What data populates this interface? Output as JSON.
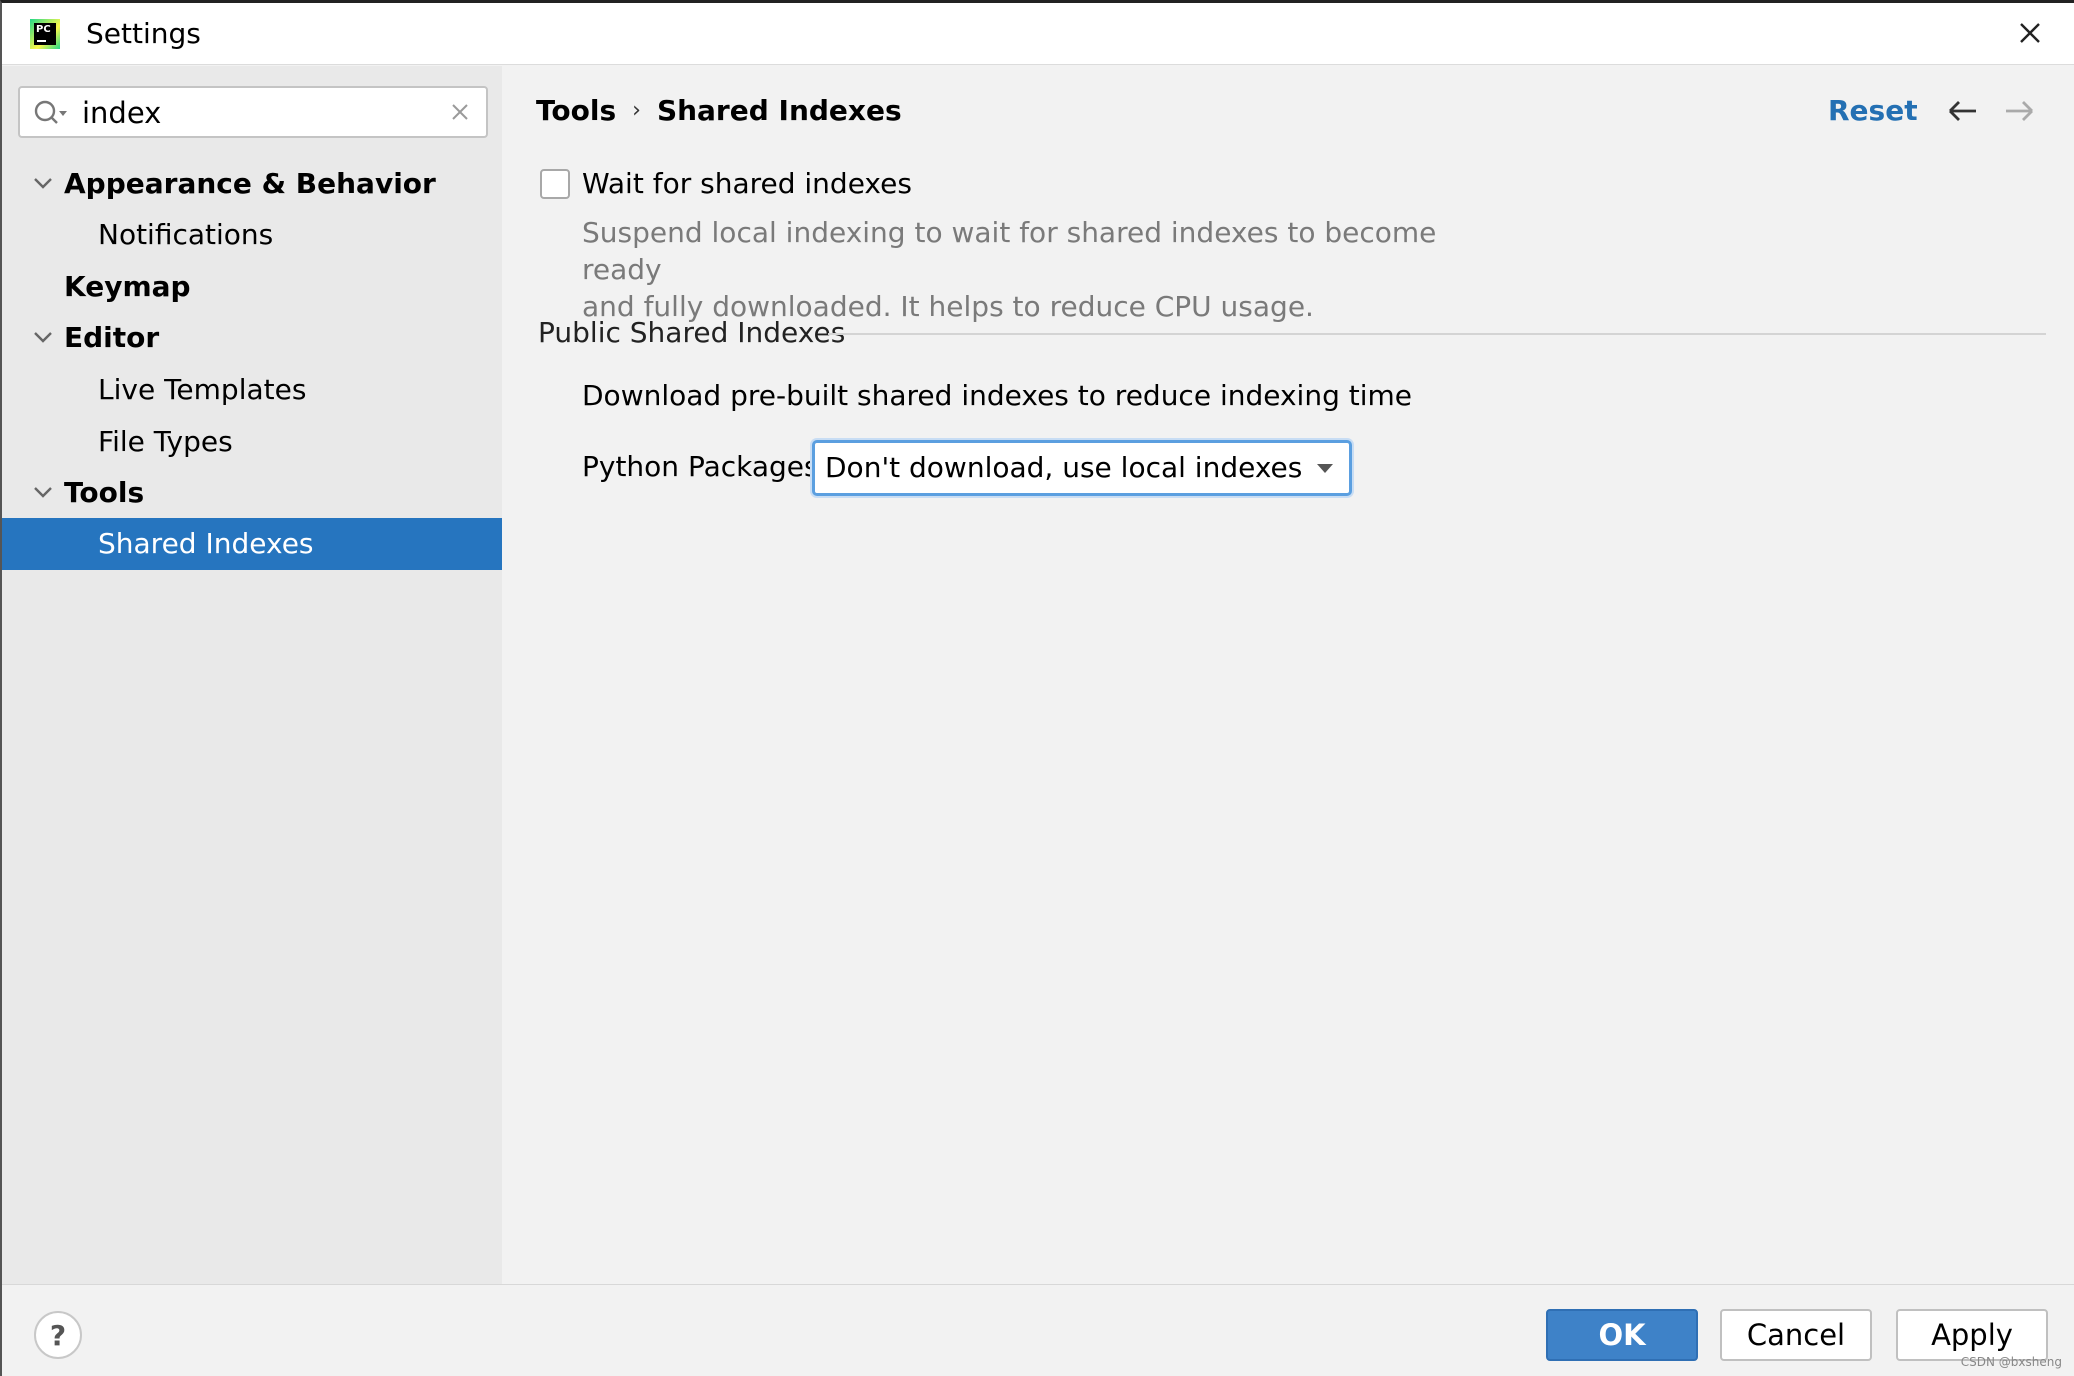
{
  "window": {
    "title": "Settings",
    "logo_text": "PC"
  },
  "search": {
    "value": "index"
  },
  "sidebar": {
    "items": [
      {
        "label": "Appearance & Behavior",
        "kind": "group",
        "expanded": true
      },
      {
        "label": "Notifications",
        "kind": "child"
      },
      {
        "label": "Keymap",
        "kind": "group",
        "expanded": false
      },
      {
        "label": "Editor",
        "kind": "group",
        "expanded": true
      },
      {
        "label": "Live Templates",
        "kind": "child"
      },
      {
        "label": "File Types",
        "kind": "child"
      },
      {
        "label": "Tools",
        "kind": "group",
        "expanded": true
      },
      {
        "label": "Shared Indexes",
        "kind": "child",
        "selected": true
      }
    ]
  },
  "header": {
    "breadcrumb_parent": "Tools",
    "breadcrumb_sep": "›",
    "breadcrumb_current": "Shared Indexes",
    "reset_label": "Reset"
  },
  "content": {
    "wait_checkbox_label": "Wait for shared indexes",
    "wait_checked": false,
    "wait_help_line1": "Suspend local indexing to wait for shared indexes to become ready",
    "wait_help_line2": "and fully downloaded. It helps to reduce CPU usage.",
    "section_title": "Public Shared Indexes",
    "section_desc": "Download pre-built shared indexes to reduce indexing time",
    "python_label": "Python Packages:",
    "python_value": "Don't download, use local indexes"
  },
  "footer": {
    "help_label": "?",
    "ok_label": "OK",
    "cancel_label": "Cancel",
    "apply_label": "Apply",
    "watermark": "CSDN @bxsheng"
  },
  "colors": {
    "selection": "#2675bf",
    "link": "#2470b3",
    "ok_button": "#3e82c8",
    "focus_border": "#5b9fe0"
  }
}
